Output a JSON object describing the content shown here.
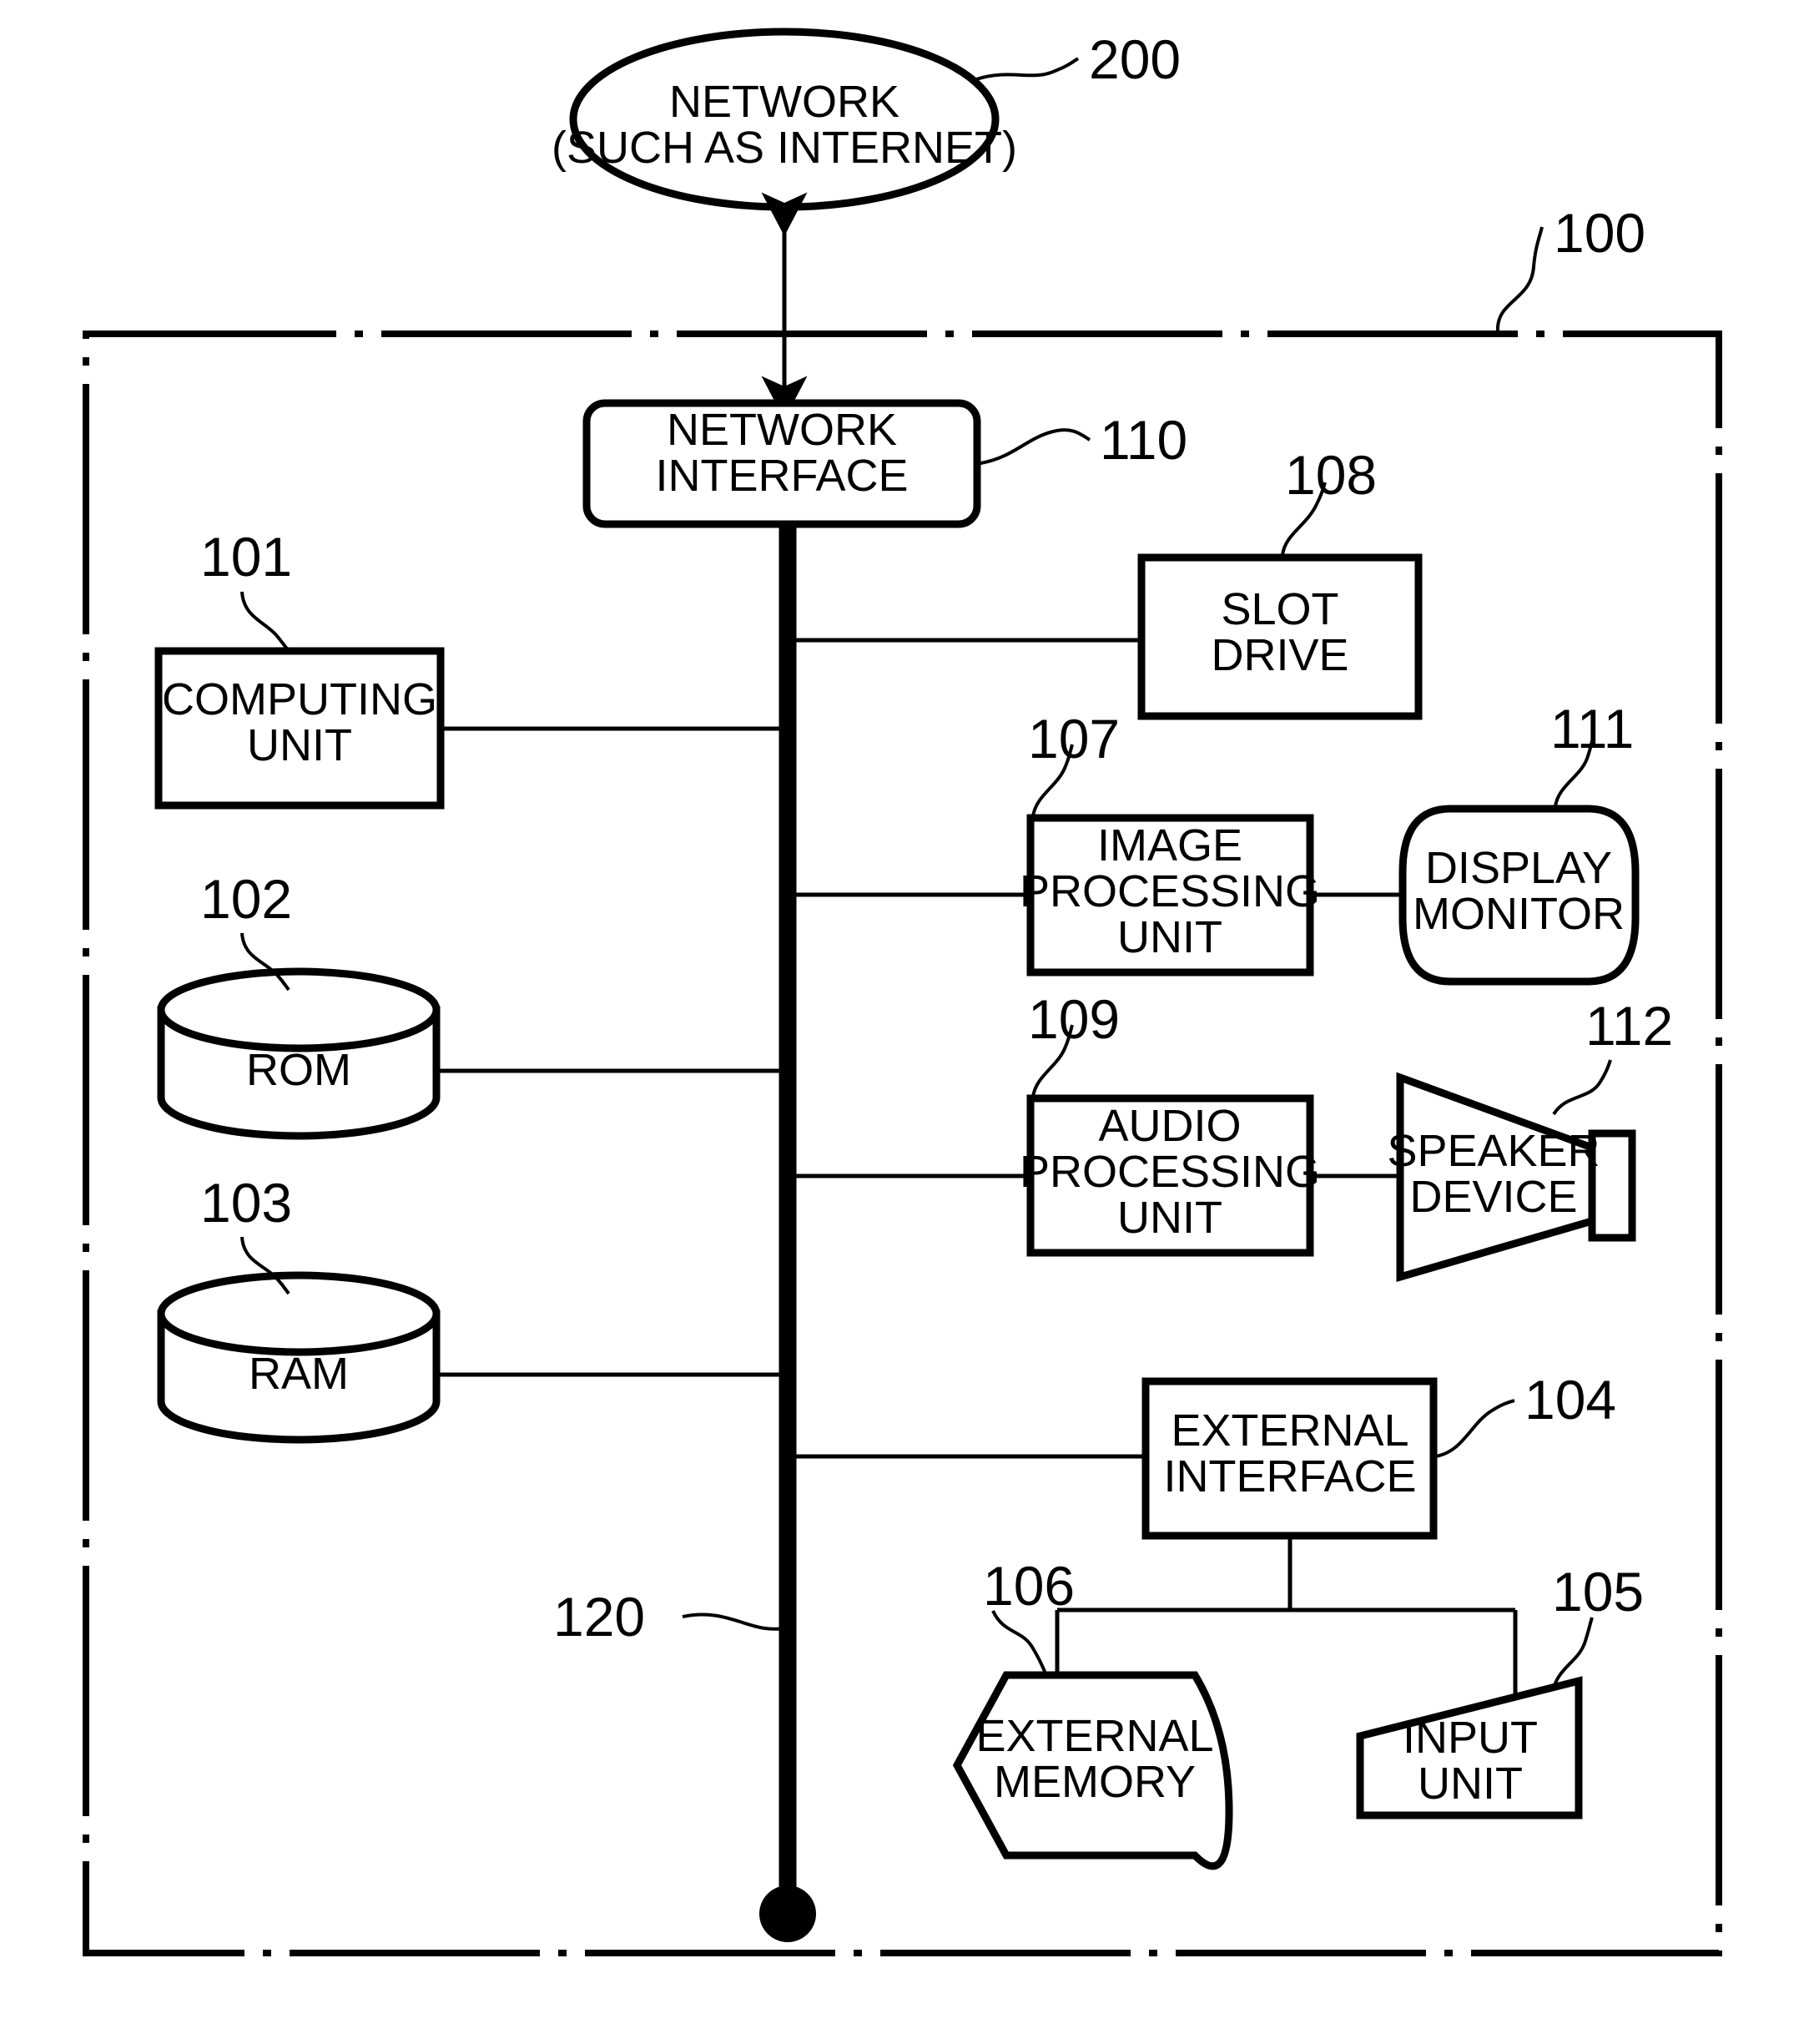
{
  "figure": {
    "title": "Computer system block diagram",
    "type": "patent-block-diagram"
  },
  "nodes": {
    "network": {
      "ref": "200",
      "line1": "NETWORK",
      "line2": "(SUCH AS INTERNET)",
      "shape": "ellipse"
    },
    "system_boundary": {
      "ref": "100",
      "shape": "dash-dot-rectangle"
    },
    "network_interface": {
      "ref": "110",
      "line1": "NETWORK",
      "line2": "INTERFACE",
      "shape": "rounded-rectangle"
    },
    "computing_unit": {
      "ref": "101",
      "line1": "COMPUTING",
      "line2": "UNIT",
      "shape": "rectangle"
    },
    "rom": {
      "ref": "102",
      "line1": "ROM",
      "shape": "cylinder"
    },
    "ram": {
      "ref": "103",
      "line1": "RAM",
      "shape": "cylinder"
    },
    "slot_drive": {
      "ref": "108",
      "line1": "SLOT",
      "line2": "DRIVE",
      "shape": "rectangle"
    },
    "image_processing_unit": {
      "ref": "107",
      "line1": "IMAGE",
      "line2": "PROCESSING",
      "line3": "UNIT",
      "shape": "rectangle"
    },
    "display_monitor": {
      "ref": "111",
      "line1": "DISPLAY",
      "line2": "MONITOR",
      "shape": "rounded-squircle"
    },
    "audio_processing_unit": {
      "ref": "109",
      "line1": "AUDIO",
      "line2": "PROCESSING",
      "line3": "UNIT",
      "shape": "rectangle"
    },
    "speaker_device": {
      "ref": "112",
      "line1": "SPEAKER",
      "line2": "DEVICE",
      "shape": "trapezoid-speaker"
    },
    "external_interface": {
      "ref": "104",
      "line1": "EXTERNAL",
      "line2": "INTERFACE",
      "shape": "rectangle"
    },
    "external_memory": {
      "ref": "106",
      "line1": "EXTERNAL",
      "line2": "MEMORY",
      "shape": "hexagon-storage"
    },
    "input_unit": {
      "ref": "105",
      "line1": "INPUT",
      "line2": "UNIT",
      "shape": "slanted-quadrilateral"
    },
    "bus": {
      "ref": "120",
      "shape": "thick-vertical-line-with-terminal-dot"
    }
  },
  "connections": [
    {
      "from": "network",
      "to": "network_interface",
      "style": "double-arrow"
    },
    {
      "from": "network_interface",
      "to": "bus",
      "style": "line"
    },
    {
      "from": "computing_unit",
      "to": "bus",
      "style": "line"
    },
    {
      "from": "rom",
      "to": "bus",
      "style": "line"
    },
    {
      "from": "ram",
      "to": "bus",
      "style": "line"
    },
    {
      "from": "bus",
      "to": "slot_drive",
      "style": "line"
    },
    {
      "from": "bus",
      "to": "image_processing_unit",
      "style": "line"
    },
    {
      "from": "image_processing_unit",
      "to": "display_monitor",
      "style": "line"
    },
    {
      "from": "bus",
      "to": "audio_processing_unit",
      "style": "line"
    },
    {
      "from": "audio_processing_unit",
      "to": "speaker_device",
      "style": "line"
    },
    {
      "from": "bus",
      "to": "external_interface",
      "style": "line"
    },
    {
      "from": "external_interface",
      "to": "external_memory",
      "style": "line"
    },
    {
      "from": "external_interface",
      "to": "input_unit",
      "style": "line"
    }
  ],
  "colors": {
    "ink": "#000000",
    "paper": "#ffffff"
  }
}
